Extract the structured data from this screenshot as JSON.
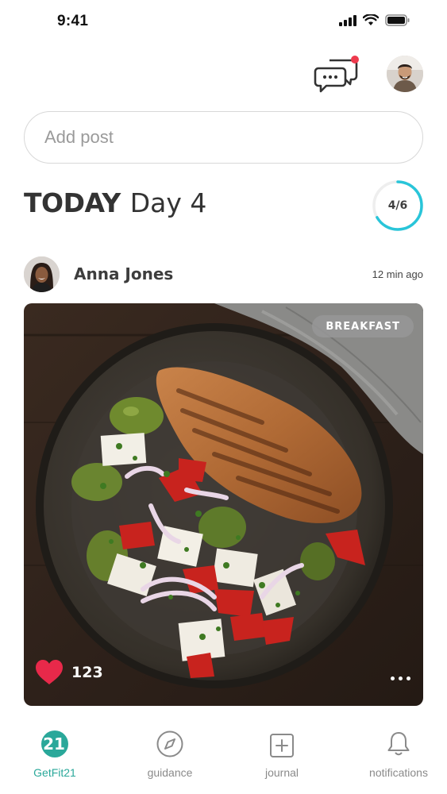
{
  "status_bar": {
    "time": "9:41"
  },
  "add_post": {
    "placeholder": "Add post"
  },
  "today": {
    "label": "TODAY",
    "day": "Day 4",
    "progress_text": "4/6",
    "progress_done": 4,
    "progress_total": 6
  },
  "post": {
    "author": "Anna Jones",
    "time": "12 min ago",
    "tag": "BREAKFAST",
    "likes": "123"
  },
  "tabs": [
    {
      "label": "GetFit21",
      "icon": "getfit21-logo-icon",
      "active": true
    },
    {
      "label": "guidance",
      "icon": "compass-icon",
      "active": false
    },
    {
      "label": "journal",
      "icon": "plus-square-icon",
      "active": false
    },
    {
      "label": "notifications",
      "icon": "bell-icon",
      "active": false
    }
  ],
  "colors": {
    "accent": "#2aa89a",
    "ring": "#29c5d9",
    "heart": "#e8294a",
    "notification_dot": "#ee3a4d"
  }
}
